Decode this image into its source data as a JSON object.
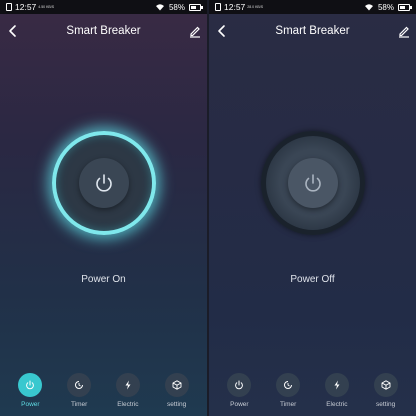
{
  "screens": [
    {
      "state": "on",
      "status_bar": {
        "time": "12:57",
        "speed": "4.50 KB/S",
        "battery": "58%",
        "battery_fraction": 0.58
      },
      "header": {
        "title": "Smart Breaker"
      },
      "status_text": "Power On",
      "tabs": [
        {
          "label": "Power",
          "icon": "power-icon",
          "active": true
        },
        {
          "label": "Timer",
          "icon": "timer-icon",
          "active": false
        },
        {
          "label": "Electric",
          "icon": "bolt-icon",
          "active": false
        },
        {
          "label": "setting",
          "icon": "cube-icon",
          "active": false
        }
      ]
    },
    {
      "state": "off",
      "status_bar": {
        "time": "12:57",
        "speed": "28.0 KB/S",
        "battery": "58%",
        "battery_fraction": 0.58
      },
      "header": {
        "title": "Smart Breaker"
      },
      "status_text": "Power Off",
      "tabs": [
        {
          "label": "Power",
          "icon": "power-icon",
          "active": false
        },
        {
          "label": "Timer",
          "icon": "timer-icon",
          "active": false
        },
        {
          "label": "Electric",
          "icon": "bolt-icon",
          "active": false
        },
        {
          "label": "setting",
          "icon": "cube-icon",
          "active": false
        }
      ]
    }
  ],
  "colors": {
    "accent": "#5fdde4",
    "glow": "#7fe8ec"
  }
}
